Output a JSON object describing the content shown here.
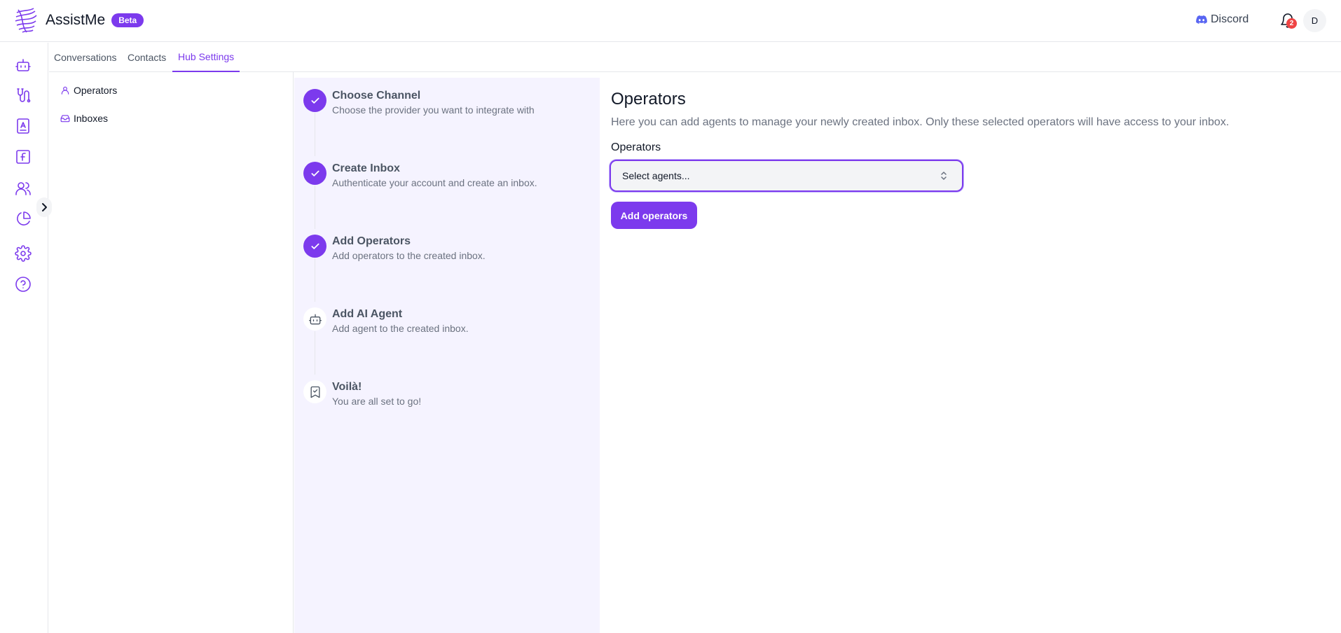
{
  "header": {
    "app_name": "AssistMe",
    "badge": "Beta",
    "discord_label": "Discord",
    "notification_count": "2",
    "avatar_initial": "D"
  },
  "rail": {
    "icons": [
      "bot-icon",
      "workflow-icon",
      "contacts-book-icon",
      "function-icon",
      "users-icon",
      "pie-chart-icon",
      "gear-icon",
      "help-icon"
    ]
  },
  "tabs": [
    {
      "label": "Conversations",
      "active": false
    },
    {
      "label": "Contacts",
      "active": false
    },
    {
      "label": "Hub Settings",
      "active": true
    }
  ],
  "subnav": {
    "items": [
      {
        "label": "Operators",
        "icon": "user-icon"
      },
      {
        "label": "Inboxes",
        "icon": "inbox-icon"
      }
    ]
  },
  "steps": [
    {
      "title": "Choose Channel",
      "desc": "Choose the provider you want to integrate with",
      "status": "done"
    },
    {
      "title": "Create Inbox",
      "desc": "Authenticate your account and create an inbox.",
      "status": "done"
    },
    {
      "title": "Add Operators",
      "desc": "Add operators to the created inbox.",
      "status": "done"
    },
    {
      "title": "Add AI Agent",
      "desc": "Add agent to the created inbox.",
      "status": "pending"
    },
    {
      "title": "Voilà!",
      "desc": "You are all set to go!",
      "status": "pending"
    }
  ],
  "main": {
    "title": "Operators",
    "description": "Here you can add agents to manage your newly created inbox. Only these selected operators will have access to your inbox.",
    "field_label": "Operators",
    "select_placeholder": "Select agents...",
    "button_label": "Add operators"
  },
  "colors": {
    "accent": "#7c3aed",
    "stepper_bg": "#f5f3ff",
    "badge_red": "#ef4444"
  }
}
